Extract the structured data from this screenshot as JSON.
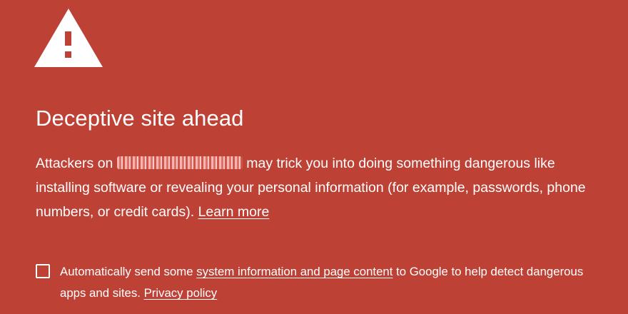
{
  "interstitial": {
    "icon": "warning-triangle-icon",
    "title": "Deceptive site ahead",
    "body": {
      "prefix": "Attackers on ",
      "site": "",
      "suffix": " may trick you into doing something dangerous like installing software or revealing your personal information (for example, passwords, phone numbers, or credit cards).",
      "learn_more_label": "Learn more"
    },
    "opt_in": {
      "checked": false,
      "text_before": "Automatically send some ",
      "link_label": "system information and page content",
      "text_after": " to Google to help detect dangerous apps and sites.",
      "privacy_label": "Privacy policy"
    }
  },
  "colors": {
    "background": "#be4136",
    "foreground": "#ffffff"
  }
}
